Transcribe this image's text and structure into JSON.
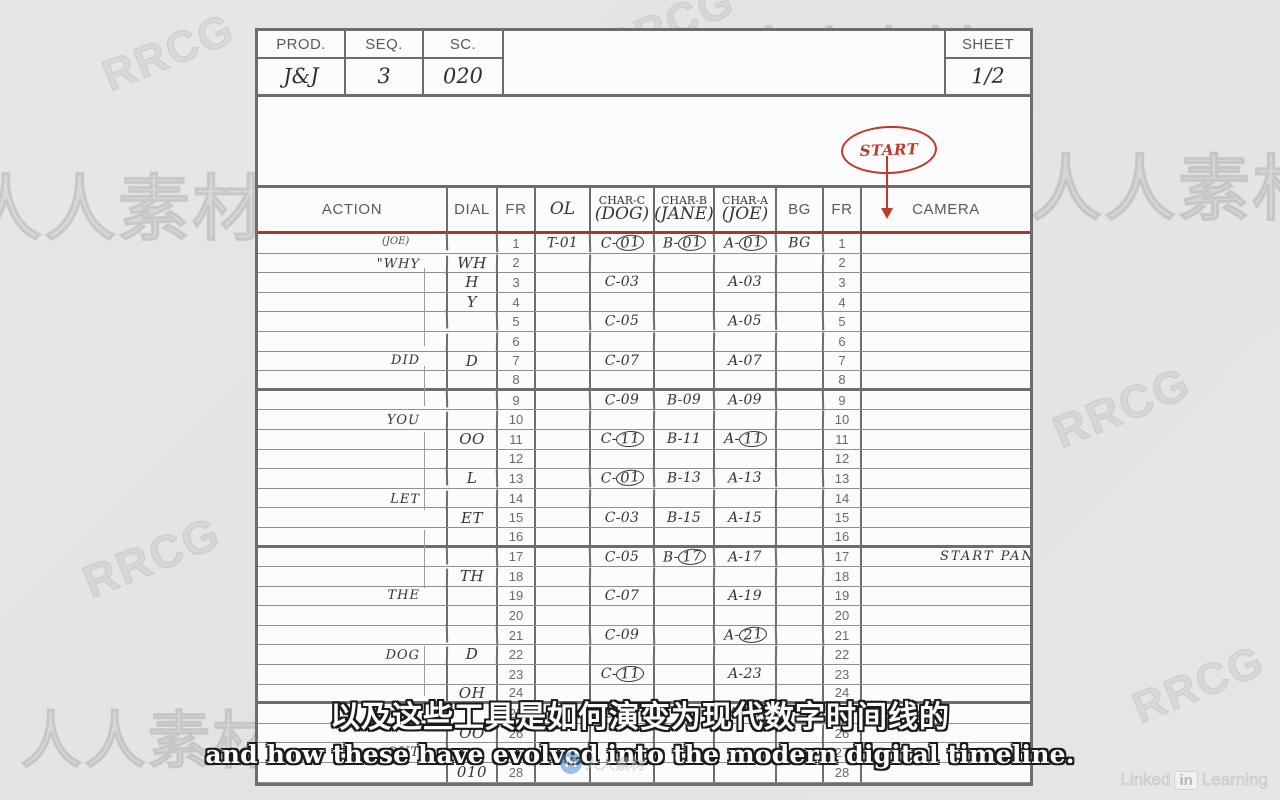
{
  "background": {
    "color": "#e5e5e5"
  },
  "watermarks": {
    "rrcg": "RRCG",
    "cn_brand": "人人素材",
    "linkedin_pre": "Linked",
    "linkedin_badge": "in",
    "linkedin_text": "Learning",
    "center_badge": "M",
    "center_text": "人人素材"
  },
  "sheet": {
    "header": {
      "prod_label": "PROD.",
      "prod_value": "J&J",
      "seq_label": "SEQ.",
      "seq_value": "3",
      "sc_label": "SC.",
      "sc_value": "020",
      "sheet_label": "SHEET",
      "sheet_value": "1/2"
    },
    "annotation": {
      "start_label": "START",
      "start_color": "#c0392b"
    },
    "columns": {
      "action": "ACTION",
      "dial": "DIAL",
      "fr_left": "FR",
      "ol": "OL",
      "char_c_top": "CHAR-C",
      "char_c_sub": "(DOG)",
      "char_b_top": "CHAR-B",
      "char_b_sub": "(JANE)",
      "char_a_top": "CHAR-A",
      "char_a_sub": "(JOE)",
      "bg": "BG",
      "fr_right": "FR",
      "camera": "CAMERA"
    },
    "speaker_tag": "(JOE)",
    "rows": [
      {
        "fr": "1",
        "action": "",
        "dial": "",
        "ol": "T-01",
        "c": "C-01",
        "c_circled": true,
        "b": "B-01",
        "b_circled": true,
        "a": "A-01",
        "a_circled": true,
        "bg": "BG",
        "camera": "",
        "thick": false
      },
      {
        "fr": "2",
        "action": "\"WHY",
        "dial": "WH",
        "ol": "",
        "c": "",
        "c_circled": false,
        "b": "",
        "b_circled": false,
        "a": "",
        "a_circled": false,
        "bg": "",
        "camera": "",
        "thick": false
      },
      {
        "fr": "3",
        "action": "",
        "dial": "H",
        "ol": "",
        "c": "C-03",
        "c_circled": false,
        "b": "",
        "b_circled": false,
        "a": "A-03",
        "a_circled": false,
        "bg": "",
        "camera": "",
        "thick": false
      },
      {
        "fr": "4",
        "action": "",
        "dial": "Y",
        "ol": "",
        "c": "",
        "c_circled": false,
        "b": "",
        "b_circled": false,
        "a": "",
        "a_circled": false,
        "bg": "",
        "camera": "",
        "thick": false
      },
      {
        "fr": "5",
        "action": "",
        "dial": "",
        "ol": "",
        "c": "C-05",
        "c_circled": false,
        "b": "",
        "b_circled": false,
        "a": "A-05",
        "a_circled": false,
        "bg": "",
        "camera": "",
        "thick": false
      },
      {
        "fr": "6",
        "action": "",
        "dial": "",
        "ol": "",
        "c": "",
        "c_circled": false,
        "b": "",
        "b_circled": false,
        "a": "",
        "a_circled": false,
        "bg": "",
        "camera": "",
        "thick": false
      },
      {
        "fr": "7",
        "action": "DID",
        "dial": "D",
        "ol": "",
        "c": "C-07",
        "c_circled": false,
        "b": "",
        "b_circled": false,
        "a": "A-07",
        "a_circled": false,
        "bg": "",
        "camera": "",
        "thick": false
      },
      {
        "fr": "8",
        "action": "",
        "dial": "",
        "ol": "",
        "c": "",
        "c_circled": false,
        "b": "",
        "b_circled": false,
        "a": "",
        "a_circled": false,
        "bg": "",
        "camera": "",
        "thick": true
      },
      {
        "fr": "9",
        "action": "",
        "dial": "",
        "ol": "",
        "c": "C-09",
        "c_circled": false,
        "b": "B-09",
        "b_circled": false,
        "a": "A-09",
        "a_circled": false,
        "bg": "",
        "camera": "",
        "thick": false
      },
      {
        "fr": "10",
        "action": "YOU",
        "dial": "",
        "ol": "",
        "c": "",
        "c_circled": false,
        "b": "",
        "b_circled": false,
        "a": "",
        "a_circled": false,
        "bg": "",
        "camera": "",
        "thick": false
      },
      {
        "fr": "11",
        "action": "",
        "dial": "OO",
        "ol": "",
        "c": "C-11",
        "c_circled": true,
        "b": "B-11",
        "b_circled": false,
        "a": "A-11",
        "a_circled": true,
        "bg": "",
        "camera": "",
        "thick": false
      },
      {
        "fr": "12",
        "action": "",
        "dial": "",
        "ol": "",
        "c": "",
        "c_circled": false,
        "b": "",
        "b_circled": false,
        "a": "",
        "a_circled": false,
        "bg": "",
        "camera": "",
        "thick": false
      },
      {
        "fr": "13",
        "action": "",
        "dial": "L",
        "ol": "",
        "c": "C-01",
        "c_circled": true,
        "b": "B-13",
        "b_circled": false,
        "a": "A-13",
        "a_circled": false,
        "bg": "",
        "camera": "",
        "thick": false
      },
      {
        "fr": "14",
        "action": "LET",
        "dial": "",
        "ol": "",
        "c": "",
        "c_circled": false,
        "b": "",
        "b_circled": false,
        "a": "",
        "a_circled": false,
        "bg": "",
        "camera": "",
        "thick": false
      },
      {
        "fr": "15",
        "action": "",
        "dial": "ET",
        "ol": "",
        "c": "C-03",
        "c_circled": false,
        "b": "B-15",
        "b_circled": false,
        "a": "A-15",
        "a_circled": false,
        "bg": "",
        "camera": "",
        "thick": false
      },
      {
        "fr": "16",
        "action": "",
        "dial": "",
        "ol": "",
        "c": "",
        "c_circled": false,
        "b": "",
        "b_circled": false,
        "a": "",
        "a_circled": false,
        "bg": "",
        "camera": "",
        "thick": true
      },
      {
        "fr": "17",
        "action": "",
        "dial": "",
        "ol": "",
        "c": "C-05",
        "c_circled": false,
        "b": "B-17",
        "b_circled": true,
        "a": "A-17",
        "a_circled": false,
        "bg": "",
        "camera": "START PAN",
        "thick": false
      },
      {
        "fr": "18",
        "action": "",
        "dial": "TH",
        "ol": "",
        "c": "",
        "c_circled": false,
        "b": "",
        "b_circled": false,
        "a": "",
        "a_circled": false,
        "bg": "",
        "camera": "",
        "thick": false
      },
      {
        "fr": "19",
        "action": "THE",
        "dial": "",
        "ol": "",
        "c": "C-07",
        "c_circled": false,
        "b": "",
        "b_circled": false,
        "a": "A-19",
        "a_circled": false,
        "bg": "",
        "camera": "",
        "thick": false
      },
      {
        "fr": "20",
        "action": "",
        "dial": "",
        "ol": "",
        "c": "",
        "c_circled": false,
        "b": "",
        "b_circled": false,
        "a": "",
        "a_circled": false,
        "bg": "",
        "camera": "",
        "thick": false
      },
      {
        "fr": "21",
        "action": "",
        "dial": "",
        "ol": "",
        "c": "C-09",
        "c_circled": false,
        "b": "",
        "b_circled": false,
        "a": "A-21",
        "a_circled": true,
        "bg": "",
        "camera": "",
        "thick": false
      },
      {
        "fr": "22",
        "action": "DOG",
        "dial": "D",
        "ol": "",
        "c": "",
        "c_circled": false,
        "b": "",
        "b_circled": false,
        "a": "",
        "a_circled": false,
        "bg": "",
        "camera": "",
        "thick": false
      },
      {
        "fr": "23",
        "action": "",
        "dial": "",
        "ol": "",
        "c": "C-11",
        "c_circled": true,
        "b": "",
        "b_circled": false,
        "a": "A-23",
        "a_circled": false,
        "bg": "",
        "camera": "",
        "thick": false
      },
      {
        "fr": "24",
        "action": "",
        "dial": "OH",
        "ol": "",
        "c": "",
        "c_circled": false,
        "b": "",
        "b_circled": false,
        "a": "",
        "a_circled": false,
        "bg": "",
        "camera": "",
        "thick": true
      },
      {
        "fr": "25",
        "action": "",
        "dial": "",
        "ol": "",
        "c": "C-01",
        "c_circled": false,
        "b": "",
        "b_circled": false,
        "a": "A-25",
        "a_circled": false,
        "bg": "",
        "camera": "",
        "thick": false
      },
      {
        "fr": "26",
        "action": "",
        "dial": "OO",
        "ol": "",
        "c": "",
        "c_circled": false,
        "b": "",
        "b_circled": false,
        "a": "",
        "a_circled": false,
        "bg": "",
        "camera": "",
        "thick": false
      },
      {
        "fr": "27",
        "action": "OUT",
        "dial": "",
        "ol": "",
        "c": "",
        "c_circled": false,
        "b": "",
        "b_circled": false,
        "a": "",
        "a_circled": false,
        "bg": "",
        "camera": "",
        "thick": false
      },
      {
        "fr": "28",
        "action": "",
        "dial": "010",
        "ol": "",
        "c": "",
        "c_circled": false,
        "b": "",
        "b_circled": false,
        "a": "",
        "a_circled": false,
        "bg": "",
        "camera": "",
        "thick": false
      }
    ]
  },
  "subtitles": {
    "chinese": "以及这些工具是如何演变为现代数字时间线的",
    "english": "and how these have evolved into the modern digital timeline."
  }
}
